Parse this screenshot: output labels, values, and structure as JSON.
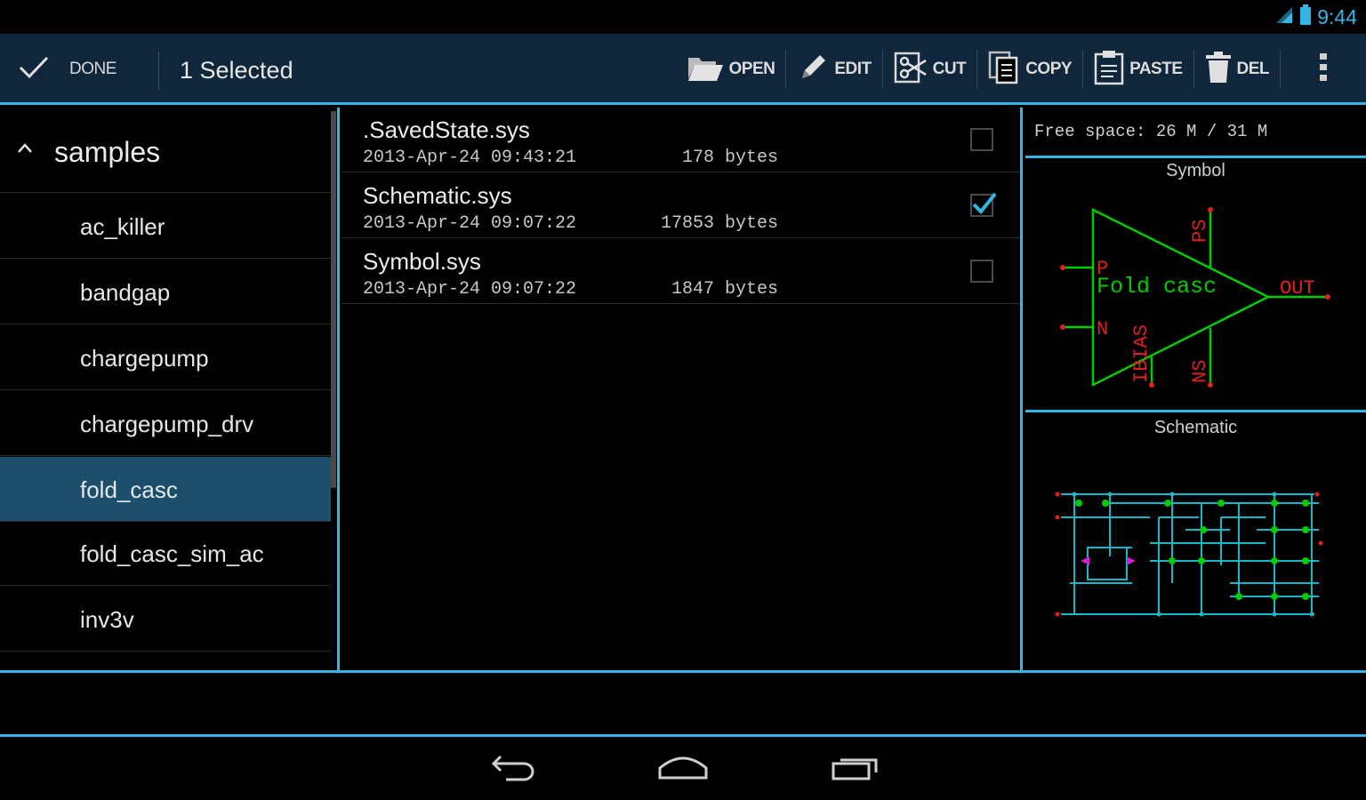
{
  "status_bar": {
    "time": "9:44",
    "icons": [
      "signal-icon",
      "battery-icon"
    ]
  },
  "action_bar": {
    "done_label": "DONE",
    "title": "1 Selected",
    "actions": [
      {
        "label": "OPEN",
        "icon": "folder-open-icon"
      },
      {
        "label": "EDIT",
        "icon": "pencil-icon"
      },
      {
        "label": "CUT",
        "icon": "scissors-icon"
      },
      {
        "label": "COPY",
        "icon": "copy-icon"
      },
      {
        "label": "PASTE",
        "icon": "clipboard-icon"
      },
      {
        "label": "DEL",
        "icon": "trash-icon"
      }
    ],
    "overflow_icon": "overflow-menu-icon"
  },
  "library": {
    "header": "samples",
    "items": [
      {
        "label": "ac_killer",
        "selected": false
      },
      {
        "label": "bandgap",
        "selected": false
      },
      {
        "label": "chargepump",
        "selected": false
      },
      {
        "label": "chargepump_drv",
        "selected": false
      },
      {
        "label": "fold_casc",
        "selected": true
      },
      {
        "label": "fold_casc_sim_ac",
        "selected": false
      },
      {
        "label": "inv3v",
        "selected": false
      }
    ]
  },
  "files": [
    {
      "name": ".SavedState.sys",
      "date": "2013-Apr-24 09:43:21",
      "size": "178 bytes",
      "checked": false
    },
    {
      "name": "Schematic.sys",
      "date": "2013-Apr-24 09:07:22",
      "size": "17853 bytes",
      "checked": true
    },
    {
      "name": "Symbol.sys",
      "date": "2013-Apr-24 09:07:22",
      "size": "1847 bytes",
      "checked": false
    }
  ],
  "preview": {
    "free_space": "Free space: 26 M / 31 M",
    "symbol_caption": "Symbol",
    "schematic_caption": "Schematic",
    "symbol": {
      "name": "Fold casc",
      "pins": [
        "P",
        "N",
        "OUT",
        "PS",
        "IBIAS",
        "NS"
      ]
    }
  },
  "nav_bar": {
    "buttons": [
      "back-icon",
      "home-icon",
      "recent-apps-icon"
    ]
  },
  "colors": {
    "accent": "#33b5e5",
    "action_bar_bg": "#10263a",
    "selected_row_bg": "#1b4f6c",
    "symbol_green": "#00cc00",
    "symbol_red": "#e02020"
  }
}
